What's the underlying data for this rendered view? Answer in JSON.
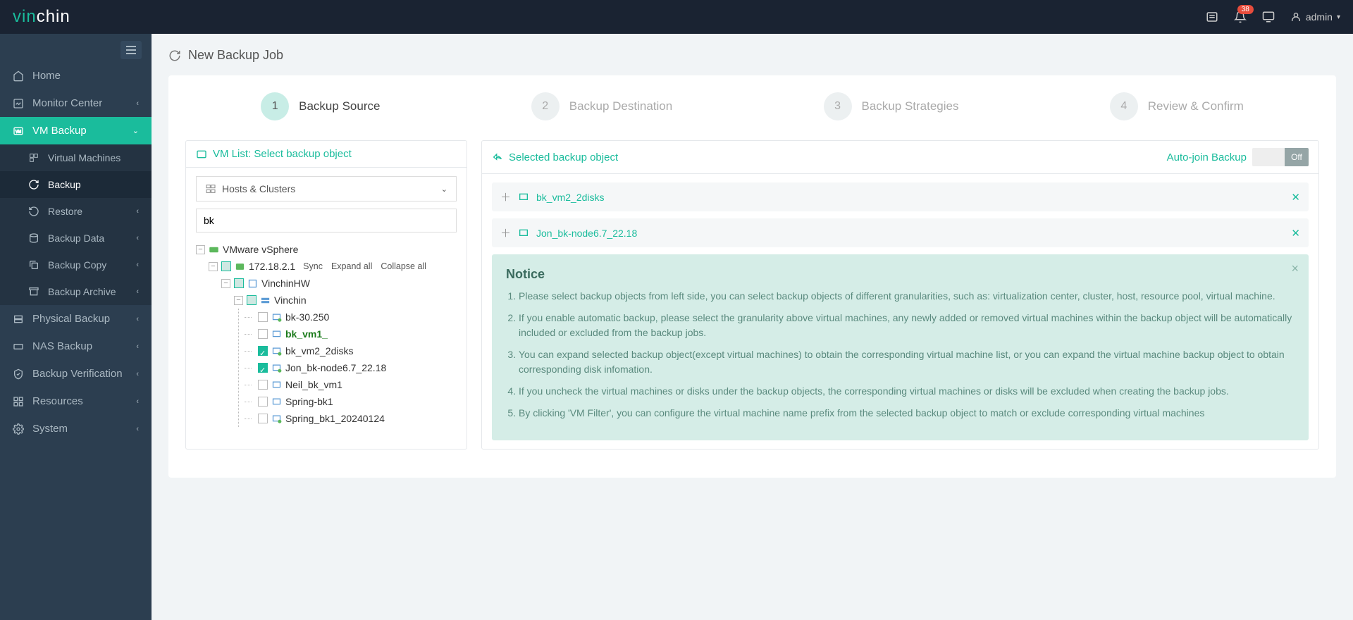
{
  "brand": {
    "p1": "vin",
    "p2": "chin"
  },
  "header": {
    "badge": "38",
    "user": "admin"
  },
  "nav": {
    "home": "Home",
    "monitor": "Monitor Center",
    "vmbackup": "VM Backup",
    "sub": {
      "vms": "Virtual Machines",
      "backup": "Backup",
      "restore": "Restore",
      "bdata": "Backup Data",
      "bcopy": "Backup Copy",
      "barchive": "Backup Archive"
    },
    "physical": "Physical Backup",
    "nas": "NAS Backup",
    "verify": "Backup Verification",
    "resources": "Resources",
    "system": "System"
  },
  "page": {
    "title": "New Backup Job"
  },
  "steps": {
    "s1": "Backup Source",
    "s2": "Backup Destination",
    "s3": "Backup Strategies",
    "s4": "Review & Confirm",
    "n1": "1",
    "n2": "2",
    "n3": "3",
    "n4": "4"
  },
  "left": {
    "title": "VM List: Select backup object",
    "selector": "Hosts & Clusters",
    "search": "bk",
    "tree": {
      "root": "VMware vSphere",
      "host": "172.18.2.1",
      "sync": "Sync",
      "expand": "Expand all",
      "collapse": "Collapse all",
      "dc": "VinchinHW",
      "cluster": "Vinchin",
      "vm1": "bk-30.250",
      "vm2": "bk_vm1_",
      "vm3": "bk_vm2_2disks",
      "vm4": "Jon_bk-node6.7_22.18",
      "vm5": "Neil_bk_vm1",
      "vm6": "Spring-bk1",
      "vm7": "Spring_bk1_20240124"
    }
  },
  "right": {
    "title": "Selected backup object",
    "autojoin": "Auto-join Backup",
    "off": "Off",
    "items": [
      "bk_vm2_2disks",
      "Jon_bk-node6.7_22.18"
    ]
  },
  "notice": {
    "title": "Notice",
    "li1": "Please select backup objects from left side, you can select backup objects of different granularities, such as: virtualization center, cluster, host, resource pool, virtual machine.",
    "li2": "If you enable automatic backup, please select the granularity above virtual machines, any newly added or removed virtual machines within the backup object will be automatically included or excluded from the backup jobs.",
    "li3": "You can expand selected backup object(except virtual machines) to obtain the corresponding virtual machine list, or you can expand the virtual machine backup object to obtain corresponding disk infomation.",
    "li4": "If you uncheck the virtual machines or disks under the backup objects, the corresponding virtual machines or disks will be excluded when creating the backup jobs.",
    "li5": "By clicking 'VM Filter', you can configure the virtual machine name prefix from the selected backup object to match or exclude corresponding virtual machines"
  }
}
